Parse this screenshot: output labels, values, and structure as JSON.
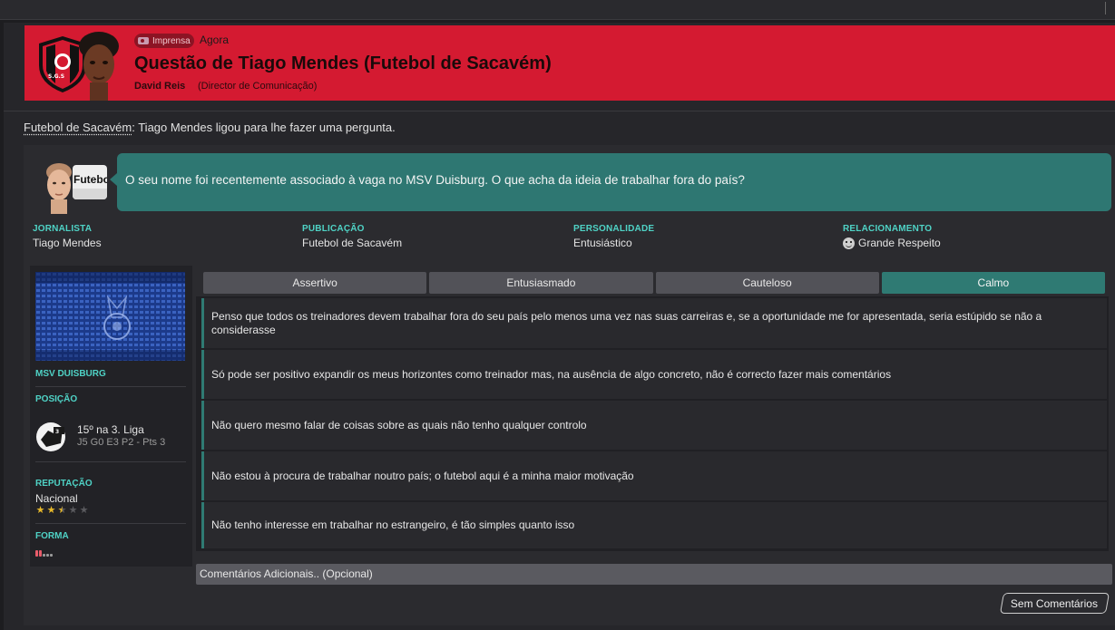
{
  "header": {
    "badge_label": "Imprensa",
    "time": "Agora",
    "title": "Questão de Tiago Mendes (Futebol de Sacavém)",
    "author_name": "David Reis",
    "author_role": "(Director de Comunicação)",
    "crest_text": "S.G.S",
    "bg_color": "#d41a31"
  },
  "intro": {
    "club": "Futebol de Sacavém",
    "text": ": Tiago Mendes ligou para lhe fazer uma pergunta."
  },
  "question": {
    "logo_text": "Futebol",
    "text": "O seu nome foi recentemente associado à vaga no MSV Duisburg. O que acha da ideia de trabalhar fora do país?"
  },
  "meta": {
    "jornalista_label": "JORNALISTA",
    "jornalista": "Tiago Mendes",
    "publicacao_label": "PUBLICAÇÃO",
    "publicacao": "Futebol de Sacavém",
    "personalidade_label": "PERSONALIDADE",
    "personalidade": "Entusiástico",
    "relacionamento_label": "RELACIONAMENTO",
    "relacionamento": "Grande Respeito"
  },
  "sidebar": {
    "club_name": "MSV DUISBURG",
    "posicao_label": "POSIÇÃO",
    "posicao": "15º na 3. Liga",
    "record": "J5 G0 E3 P2 - Pts 3",
    "reputacao_label": "REPUTAÇÃO",
    "reputacao": "Nacional",
    "reputacao_stars": 2.5,
    "forma_label": "FORMA"
  },
  "tabs": [
    {
      "label": "Assertivo",
      "active": false
    },
    {
      "label": "Entusiasmado",
      "active": false
    },
    {
      "label": "Cauteloso",
      "active": false
    },
    {
      "label": "Calmo",
      "active": true
    }
  ],
  "answers": [
    "Penso que todos os treinadores devem trabalhar fora do seu país pelo menos uma vez nas suas carreiras e, se a oportunidade me for apresentada, seria estúpido se não a considerasse",
    "Só pode ser positivo expandir os meus horizontes como treinador mas, na ausência de algo concreto, não é correcto fazer mais comentários",
    "Não quero mesmo falar de coisas sobre as quais não tenho qualquer controlo",
    "Não estou à procura de trabalhar noutro país; o futebol aqui é a minha maior motivação",
    "Não tenho interesse em trabalhar no estrangeiro, é tão simples quanto isso"
  ],
  "comments_placeholder": "Comentários Adicionais.. (Opcional)",
  "no_comments_label": "Sem Comentários",
  "colors": {
    "accent": "#2f7a73",
    "label": "#4fd3c6",
    "header": "#d41a31"
  }
}
